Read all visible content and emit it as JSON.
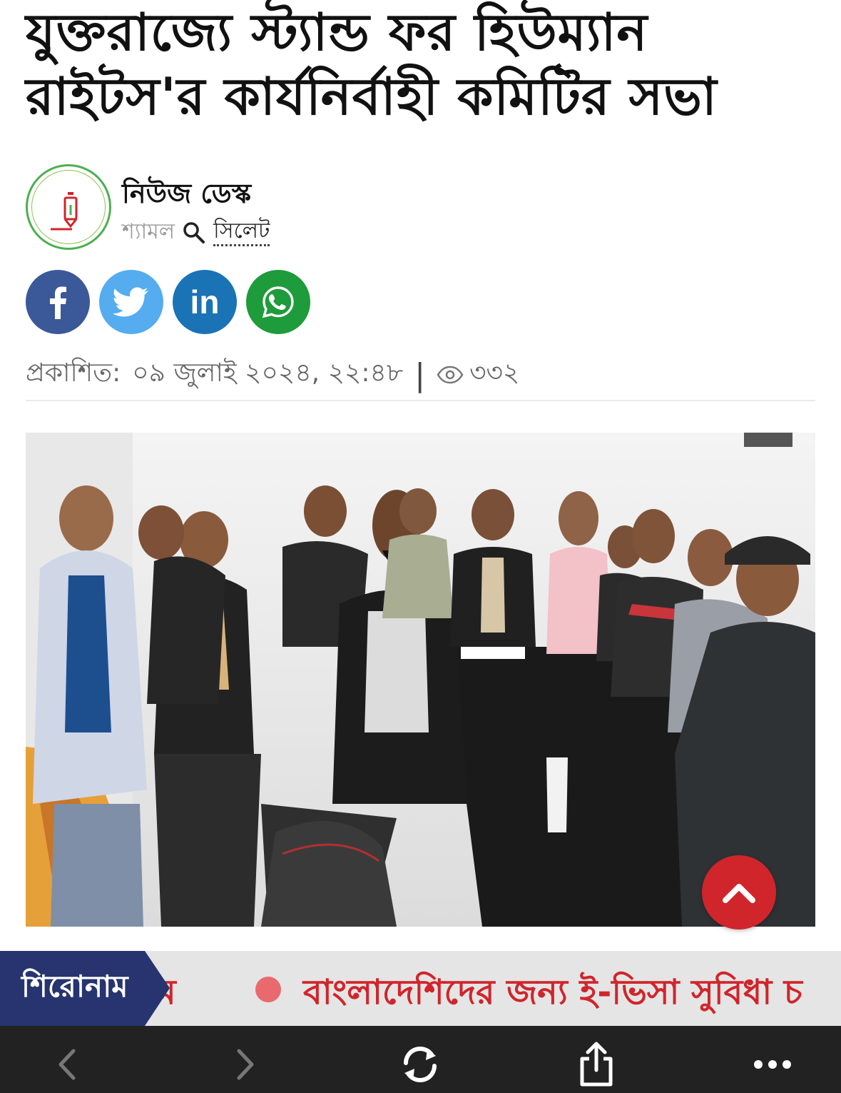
{
  "article": {
    "headline": "যুক্তরাজ্যে স্ট্যান্ড ফর হিউম্যান রাইটস'র কার্যনির্বাহী কমিটির সভা",
    "author_name": "নিউজ ডেস্ক",
    "author_area": "শ্যামল",
    "author_location": "সিলেট",
    "published_label": "প্রকাশিত:",
    "published_datetime": "০৯ জুলাই ২০২৪, ২২:৪৮",
    "separator": "|",
    "views": "৩৩২"
  },
  "share": {
    "facebook_icon": "facebook-icon",
    "twitter_icon": "twitter-icon",
    "linkedin_icon": "linkedin-icon",
    "whatsapp_icon": "whatsapp-icon",
    "linkedin_text": "in"
  },
  "ticker": {
    "label": "শিরোনাম",
    "prev_fragment": "ম",
    "headline": "বাংলাদেশিদের জন্য ই-ভিসা সুবিধা চ"
  },
  "colors": {
    "facebook": "#3b5998",
    "twitter": "#55acee",
    "linkedin": "#1a73b5",
    "whatsapp": "#1e9b3b",
    "accent_red": "#d0252b",
    "ticker_label_bg": "#27346f"
  },
  "browser": {
    "back_icon": "chevron-left-icon",
    "forward_icon": "chevron-right-icon",
    "reload_icon": "reload-icon",
    "share_icon": "share-icon",
    "more_icon": "more-icon"
  }
}
